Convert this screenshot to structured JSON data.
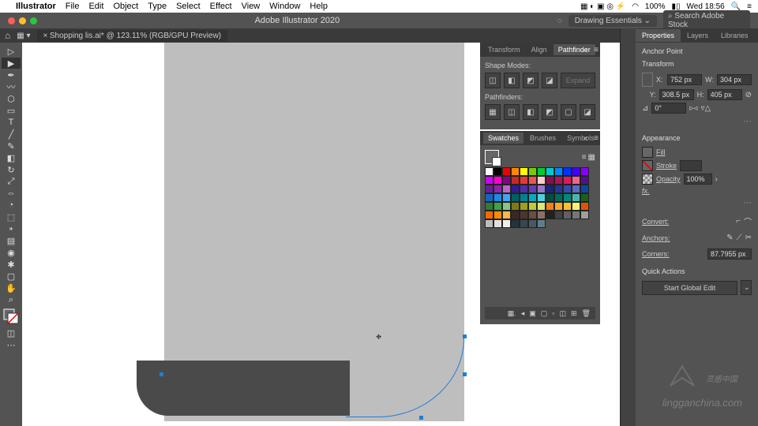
{
  "mac_menu": {
    "app": "Illustrator",
    "items": [
      "File",
      "Edit",
      "Object",
      "Type",
      "Select",
      "Effect",
      "View",
      "Window",
      "Help"
    ],
    "battery": "100%",
    "time": "Wed 18:56"
  },
  "app_bar": {
    "title": "Adobe Illustrator 2020",
    "workspace": "Drawing Essentials",
    "search_placeholder": "Search Adobe Stock"
  },
  "doc_tab": {
    "label": "Shopping lis.ai* @ 123.11% (RGB/GPU Preview)",
    "close": "×"
  },
  "pathfinder": {
    "tabs": [
      "Transform",
      "Align",
      "Pathfinder"
    ],
    "shape_modes": "Shape Modes:",
    "pathfinders": "Pathfinders:",
    "expand": "Expand"
  },
  "swatches": {
    "tabs": [
      "Swatches",
      "Brushes",
      "Symbols"
    ]
  },
  "swatch_colors": [
    "#fff",
    "#000",
    "#e00",
    "#f80",
    "#ff0",
    "#7c0",
    "#0c3",
    "#0cc",
    "#08f",
    "#03f",
    "#40f",
    "#80f",
    "#c0f",
    "#f0c",
    "#808",
    "#c62828",
    "#e53935",
    "#ef5350",
    "#ffcdd2",
    "#880e4f",
    "#ad1457",
    "#d81b60",
    "#f06292",
    "#4a148c",
    "#6a1b9a",
    "#8e24aa",
    "#ba68c8",
    "#311b92",
    "#512da8",
    "#673ab7",
    "#9575cd",
    "#1a237e",
    "#283593",
    "#3949ab",
    "#5c6bc0",
    "#0d47a1",
    "#1565c0",
    "#1e88e5",
    "#42a5f5",
    "#006064",
    "#00838f",
    "#00acc1",
    "#4dd0e1",
    "#004d40",
    "#00695c",
    "#00897b",
    "#4db6ac",
    "#1b5e20",
    "#2e7d32",
    "#43a047",
    "#81c784",
    "#827717",
    "#9e9d24",
    "#c0ca33",
    "#dce775",
    "#f57f17",
    "#f9a825",
    "#fbc02d",
    "#fff176",
    "#e65100",
    "#ef6c00",
    "#fb8c00",
    "#ffb74d",
    "#3e2723",
    "#4e342e",
    "#6d4c41",
    "#8d6e63",
    "#212121",
    "#424242",
    "#616161",
    "#757575",
    "#9e9e9e",
    "#bdbdbd",
    "#e0e0e0",
    "#eeeeee",
    "#263238",
    "#37474f",
    "#455a64",
    "#607d8b"
  ],
  "properties": {
    "tabs": [
      "Properties",
      "Layers",
      "Libraries"
    ],
    "section": "Anchor Point",
    "transform": "Transform",
    "x": "752 px",
    "y": "308.5 px",
    "w": "304 px",
    "h": "405 px",
    "angle": "0°",
    "appearance": "Appearance",
    "fill": "Fill",
    "stroke": "Stroke",
    "opacity_label": "Opacity",
    "opacity": "100%",
    "fx": "fx.",
    "convert": "Convert:",
    "anchors": "Anchors:",
    "corners": "Corners:",
    "corners_val": "87.7955 px",
    "quick": "Quick Actions",
    "global_edit": "Start Global Edit"
  },
  "watermark": {
    "cn": "灵感中国",
    "en": "lingganchina.com"
  }
}
